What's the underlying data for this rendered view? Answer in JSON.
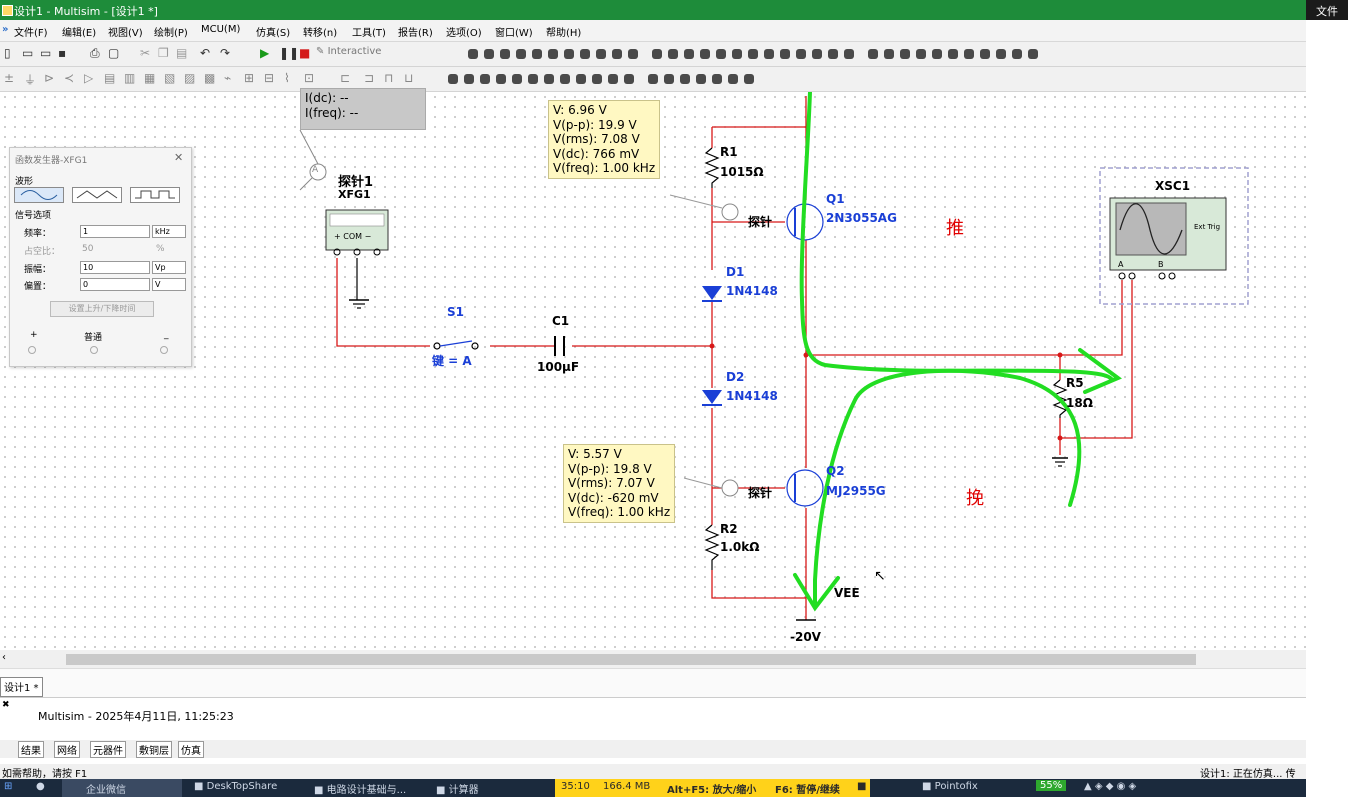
{
  "window": {
    "title": "设计1 - Multisim - [设计1 *]",
    "top_right_text": "文件"
  },
  "menu": [
    "文件(F)",
    "编辑(E)",
    "视图(V)",
    "绘制(P)",
    "MCU(M)",
    "仿真(S)",
    "转移(n)",
    "工具(T)",
    "报告(R)",
    "选项(O)",
    "窗口(W)",
    "帮助(H)"
  ],
  "toolbar": {
    "interactive_label": "Interactive"
  },
  "function_generator": {
    "title": "函数发生器-XFG1",
    "waveform_label": "波形",
    "signal_options_label": "信号选项",
    "fields": [
      {
        "label": "频率：",
        "value": "1",
        "unit": "kHz"
      },
      {
        "label": "占空比：",
        "value": "50",
        "unit": "%"
      },
      {
        "label": "振幅：",
        "value": "10",
        "unit": "Vp"
      },
      {
        "label": "偏置：",
        "value": "0",
        "unit": "V"
      }
    ],
    "rise_fall_button": "设置上升/下降时间",
    "plus": "+",
    "common": "普通",
    "minus": "_"
  },
  "probe_current": {
    "lines": [
      "I(dc): --",
      "I(freq): --"
    ]
  },
  "probe1": {
    "label": "探针1",
    "lines": [
      "V: 6.96 V",
      "V(p-p): 19.9 V",
      "V(rms): 7.08 V",
      "V(dc): 766 mV",
      "V(freq): 1.00 kHz"
    ]
  },
  "probe2": {
    "lines": [
      "V: 5.57 V",
      "V(p-p): 19.8 V",
      "V(rms): 7.07 V",
      "V(dc): -620 mV",
      "V(freq): 1.00 kHz"
    ]
  },
  "components": {
    "xfg_name": "XFG1",
    "xfg_pins": "+ COM −",
    "r1": {
      "name": "R1",
      "value": "1015Ω"
    },
    "q1": {
      "name": "Q1",
      "model": "2N3055AG"
    },
    "d1": {
      "name": "D1",
      "model": "1N4148"
    },
    "d2": {
      "name": "D2",
      "model": "1N4148"
    },
    "q2": {
      "name": "Q2",
      "model": "MJ2955G"
    },
    "r2": {
      "name": "R2",
      "value": "1.0kΩ"
    },
    "s1": {
      "name": "S1",
      "key": "键 = A"
    },
    "c1": {
      "name": "C1",
      "value": "100μF"
    },
    "r5": {
      "name": "R5",
      "value": "18Ω"
    },
    "xsc": {
      "name": "XSC1",
      "ext_trig": "Ext Trig",
      "a": "A",
      "b": "B"
    },
    "vee": {
      "name": "VEE",
      "value": "-20V"
    },
    "probe_tag": "探针"
  },
  "annotations": {
    "push": "推",
    "pull": "挽"
  },
  "doc_tab": "设计1 *",
  "output": {
    "line": "Multisim  -  2025年4月11日, 11:25:23"
  },
  "bottom_tabs": [
    "结果",
    "网络",
    "元器件",
    "敷铜层",
    "仿真"
  ],
  "status": {
    "left": "如需帮助，请按 F1",
    "right": "设计1: 正在仿真... 传"
  },
  "taskbar": {
    "items": [
      "企业微信",
      "DeskTopShare",
      "电路设计基础与...",
      "计算器",
      "Pointofix"
    ],
    "recording": {
      "time": "35:10",
      "size": "166.4 MB",
      "hint1": "Alt+F5: 放大/缩小",
      "hint2": "F6: 暂停/继续"
    },
    "battery": "55%"
  },
  "colors": {
    "wire": "#d81818",
    "pen": "#22dd22",
    "title_bg": "#1e8c3a",
    "component_blue": "#1a3fd6"
  }
}
